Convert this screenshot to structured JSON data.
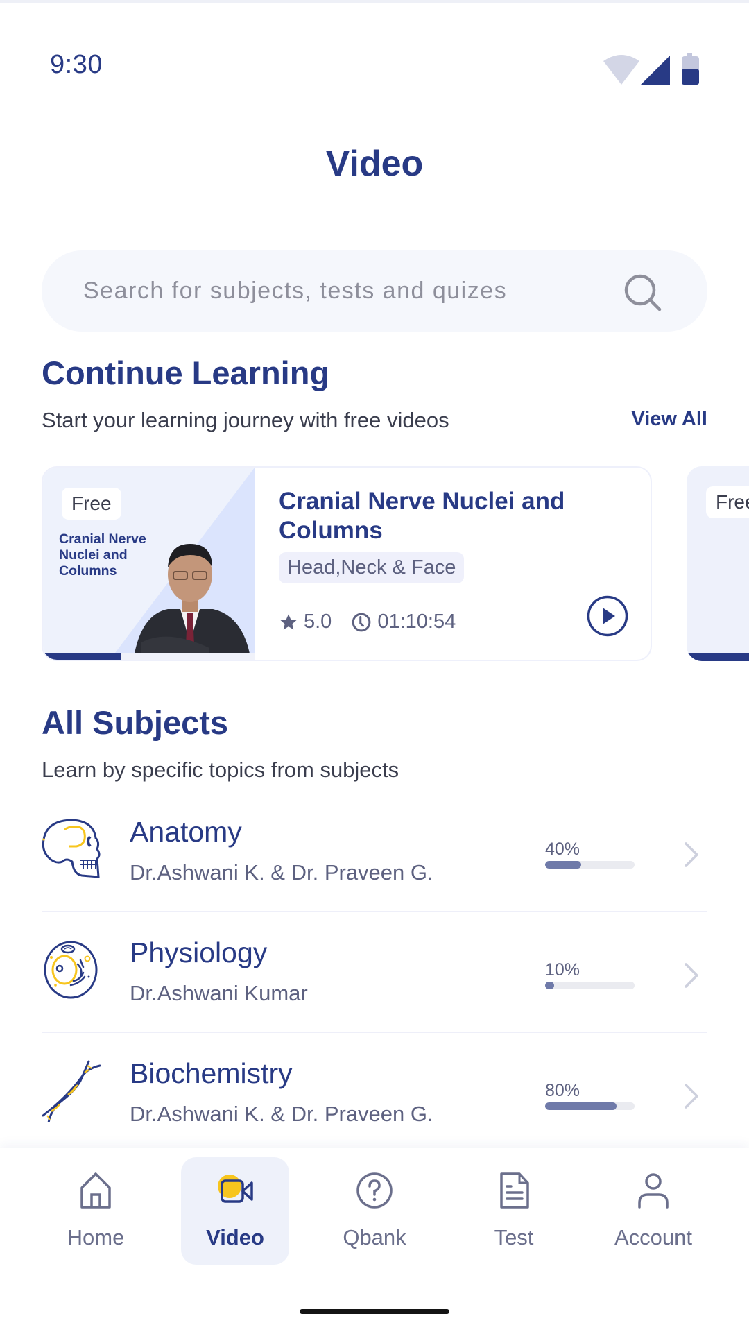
{
  "status_bar": {
    "time": "9:30",
    "icons": [
      "wifi-icon",
      "cellular-signal-icon",
      "battery-icon"
    ],
    "battery_level_percent": 55
  },
  "header": {
    "title": "Video"
  },
  "search": {
    "placeholder": "Search for subjects, tests and quizes",
    "value": ""
  },
  "continue_learning": {
    "title": "Continue Learning",
    "subtitle": "Start your learning journey with free videos",
    "view_all_label": "View All",
    "cards": [
      {
        "badge": "Free",
        "thumbnail_text": "Cranial Nerve Nuclei and Columns",
        "title": "Cranial Nerve Nuclei and Columns",
        "tag": "Head,Neck & Face",
        "rating": "5.0",
        "duration": "01:10:54",
        "watch_progress_fraction": 0.37
      },
      {
        "badge": "Free"
      }
    ]
  },
  "all_subjects": {
    "title": "All Subjects",
    "subtitle": "Learn by specific topics from subjects",
    "items": [
      {
        "name": "Anatomy",
        "teacher": "Dr.Ashwani K. & Dr. Praveen G.",
        "progress_label": "40%",
        "progress": 40,
        "icon": "skull-icon"
      },
      {
        "name": "Physiology",
        "teacher": "Dr.Ashwani Kumar",
        "progress_label": "10%",
        "progress": 10,
        "icon": "cell-icon"
      },
      {
        "name": "Biochemistry",
        "teacher": "Dr.Ashwani K. & Dr. Praveen G.",
        "progress_label": "80%",
        "progress": 80,
        "icon": "dna-icon"
      }
    ]
  },
  "bottom_nav": {
    "items": [
      {
        "label": "Home",
        "icon": "home-icon",
        "active": false
      },
      {
        "label": "Video",
        "icon": "video-camera-icon",
        "active": true
      },
      {
        "label": "Qbank",
        "icon": "question-circle-icon",
        "active": false
      },
      {
        "label": "Test",
        "icon": "document-icon",
        "active": false
      },
      {
        "label": "Account",
        "icon": "user-icon",
        "active": false
      }
    ]
  },
  "colors": {
    "primary": "#283a85",
    "accent_yellow": "#f7c51e",
    "progress_fill": "#6f7aa9",
    "muted_text": "#5d6180",
    "search_bg": "#f5f7fc"
  }
}
